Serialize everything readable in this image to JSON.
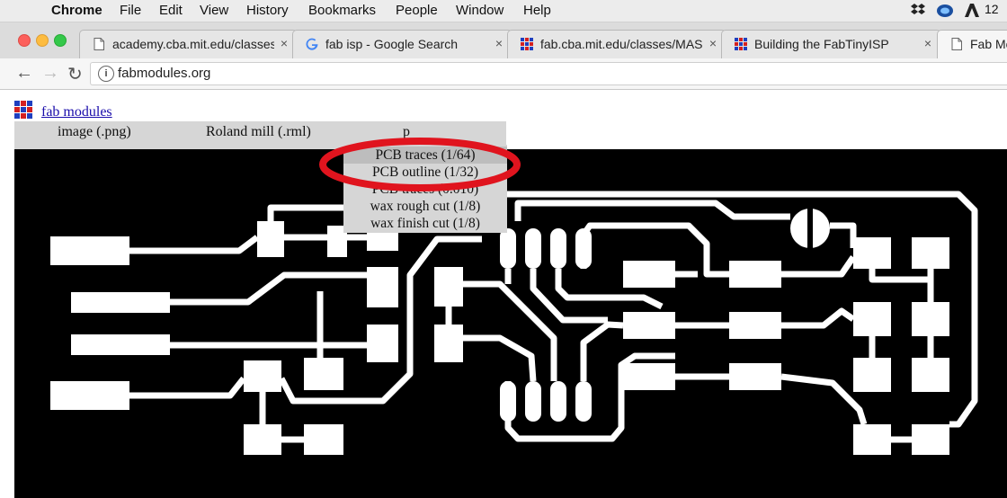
{
  "menubar": {
    "apple": "",
    "app": "Chrome",
    "items": [
      "File",
      "Edit",
      "View",
      "History",
      "Bookmarks",
      "People",
      "Window",
      "Help"
    ],
    "clock": "12"
  },
  "tabs": [
    {
      "title": "academy.cba.mit.edu/classes/",
      "icon": "page-icon"
    },
    {
      "title": "fab isp - Google Search",
      "icon": "google-icon"
    },
    {
      "title": "fab.cba.mit.edu/classes/MAS",
      "icon": "fab-grid-icon"
    },
    {
      "title": "Building the FabTinyISP",
      "icon": "fab-grid-icon"
    },
    {
      "title": "Fab Mo",
      "icon": "page-icon"
    }
  ],
  "tab_close": "×",
  "toolbar": {
    "back": "←",
    "forward": "→",
    "reload": "↻",
    "info": "i",
    "url": "fabmodules.org"
  },
  "page": {
    "logo_link": "fab modules",
    "menu": {
      "input": "image (.png)",
      "output": "Roland mill (.rml)",
      "process_partial": "p"
    },
    "process_options": [
      "PCB traces (1/64)",
      "PCB outline (1/32)",
      "PCB traces (0.010)",
      "wax rough cut (1/8)",
      "wax finish cut (1/8)"
    ],
    "highlighted_option_index": 0,
    "annotation_color": "#e0141e"
  },
  "colors": {
    "menubar_bg": "#ececec",
    "board_bg": "#000000",
    "trace": "#ffffff",
    "link": "#1a0dab"
  }
}
